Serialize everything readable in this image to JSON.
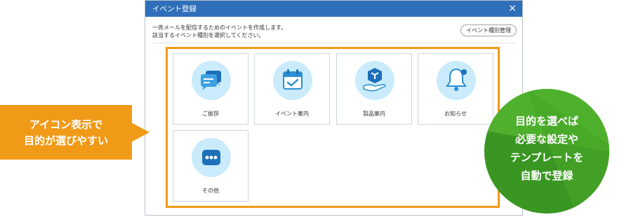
{
  "dialog": {
    "title": "イベント登録",
    "close_symbol": "×",
    "description_line1": "一斉メールを配信するためのイベントを作成します。",
    "description_line2": "該当するイベント種別を選択してください。",
    "type_manage_button": "イベント種別管理"
  },
  "event_types": [
    {
      "label": "ご挨拶",
      "icon": "speech-bubbles-icon"
    },
    {
      "label": "イベント案内",
      "icon": "calendar-check-icon"
    },
    {
      "label": "製品案内",
      "icon": "product-box-hand-icon"
    },
    {
      "label": "お知らせ",
      "icon": "bell-icon"
    },
    {
      "label": "その他",
      "icon": "more-dots-icon"
    }
  ],
  "callouts": {
    "left_line1": "アイコン表示で",
    "left_line2": "目的が選びやすい",
    "right_line1": "目的を選べば",
    "right_line2": "必要な設定や",
    "right_line3": "テンプレートを",
    "right_line4": "自動で登録"
  },
  "colors": {
    "titlebar": "#2f6fb9",
    "icon_bg": "#c9ebfb",
    "icon_blue": "#2c8fd3",
    "highlight": "#f29a1a",
    "callout_orange": "#f19a18",
    "callout_green": "#3e9c23"
  }
}
